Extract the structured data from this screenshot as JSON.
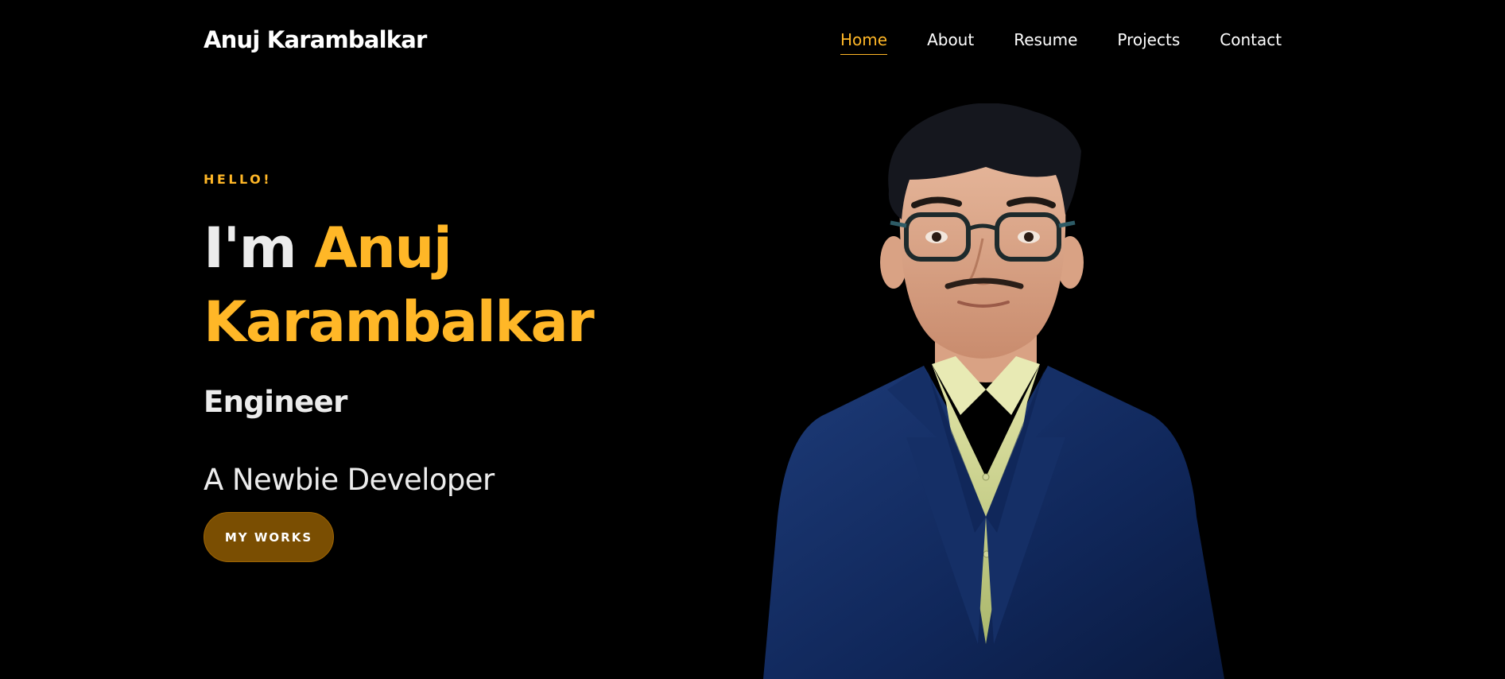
{
  "header": {
    "brand": "Anuj Karambalkar",
    "nav": [
      {
        "label": "Home",
        "active": true
      },
      {
        "label": "About",
        "active": false
      },
      {
        "label": "Resume",
        "active": false
      },
      {
        "label": "Projects",
        "active": false
      },
      {
        "label": "Contact",
        "active": false
      }
    ]
  },
  "hero": {
    "greeting": "HELLO!",
    "title_prefix": "I'm",
    "title_first_name": "Anuj",
    "title_last_name": "Karambalkar",
    "role": "Engineer",
    "tagline": "A Newbie Developer",
    "cta_label": "MY WORKS"
  },
  "colors": {
    "background": "#000000",
    "accent": "#ffb727",
    "text": "#ececec",
    "button_bg": "#7a4e02"
  }
}
